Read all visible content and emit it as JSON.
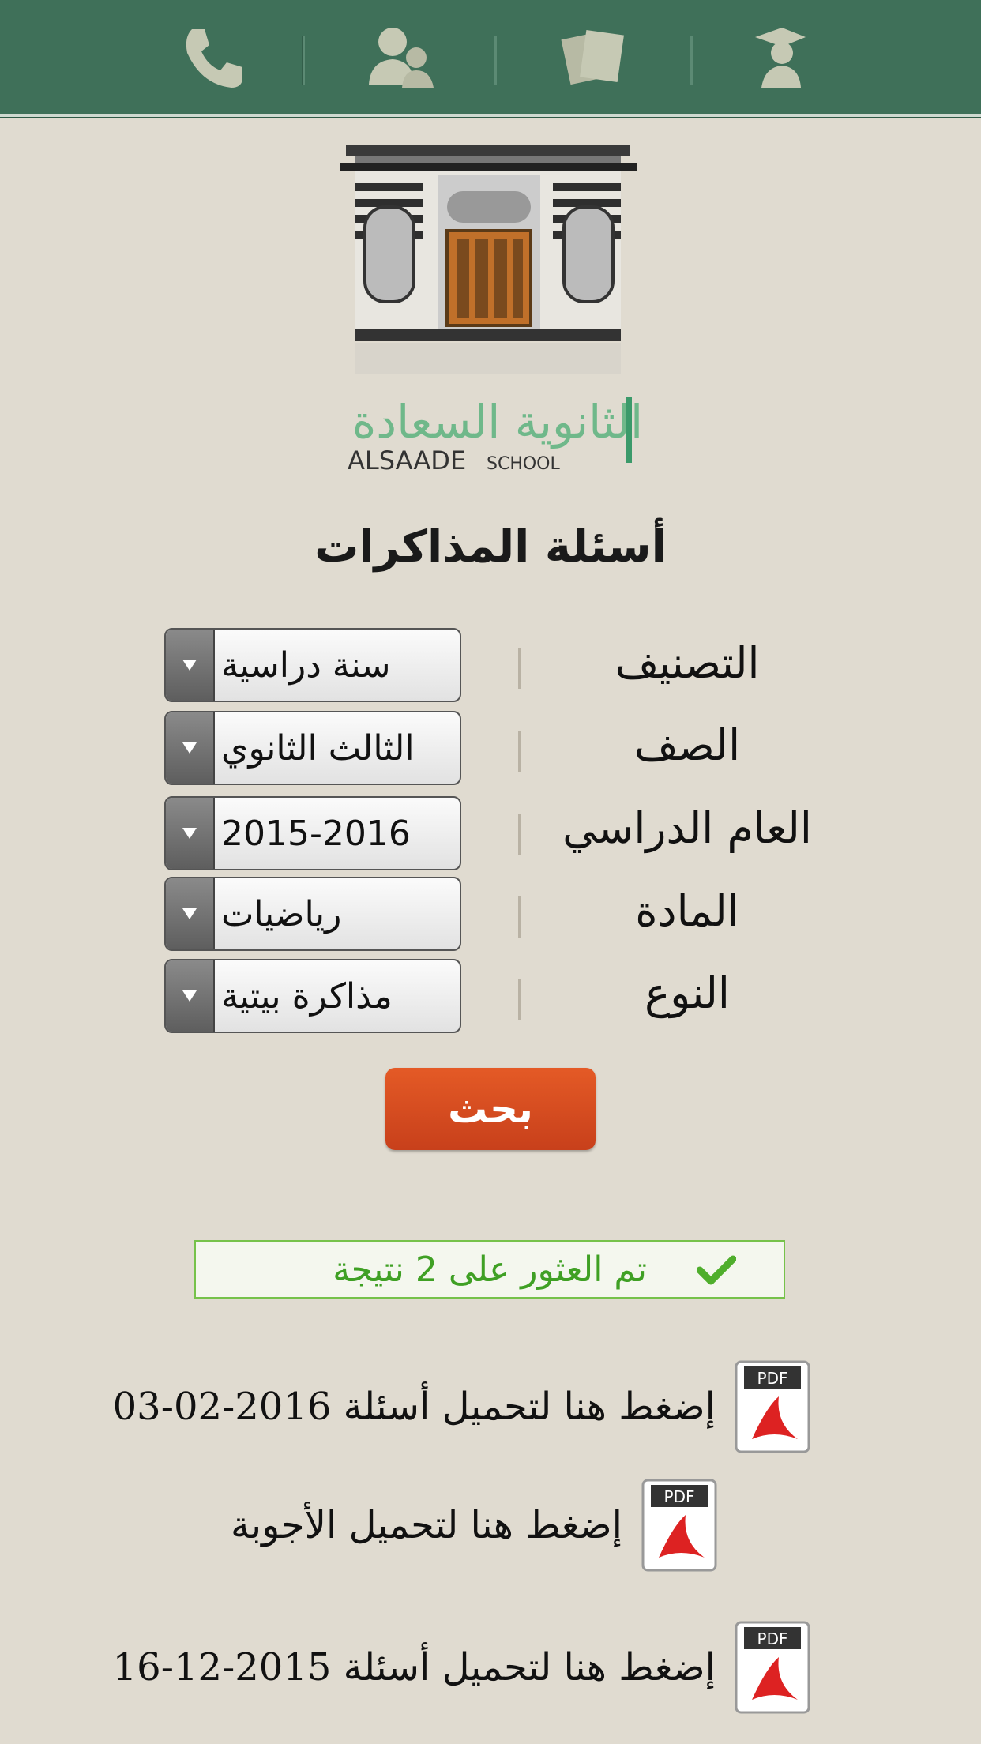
{
  "nav": {
    "items": [
      {
        "name": "phone-icon"
      },
      {
        "name": "users-icon"
      },
      {
        "name": "papers-icon"
      },
      {
        "name": "graduate-icon"
      }
    ]
  },
  "logo": {
    "arabic": "الثانوية السعادة",
    "latin_main": "ALSAADE",
    "latin_small": "SCHOOL"
  },
  "page_title": "أسئلة المذاكرات",
  "form": {
    "rows": [
      {
        "label": "التصنيف",
        "value": "سنة دراسية"
      },
      {
        "label": "الصف",
        "value": "الثالث الثانوي"
      },
      {
        "label": "العام الدراسي",
        "value": "2015-2016"
      },
      {
        "label": "المادة",
        "value": "رياضيات"
      },
      {
        "label": "النوع",
        "value": "مذاكرة بيتية"
      }
    ],
    "search_label": "بحث"
  },
  "result": {
    "text": "تم العثور على 2 نتيجة"
  },
  "downloads": [
    {
      "text": "إضغط هنا لتحميل أسئلة 2016-02-03",
      "badge": "PDF"
    },
    {
      "text": "إضغط هنا لتحميل الأجوبة",
      "badge": "PDF"
    },
    {
      "text": "إضغط هنا لتحميل أسئلة 2015-12-16",
      "badge": "PDF"
    }
  ],
  "colors": {
    "nav_bg": "#3f7059",
    "page_bg": "#e0dbd0",
    "accent_orange": "#d94a1f",
    "success_green": "#3fa024"
  }
}
